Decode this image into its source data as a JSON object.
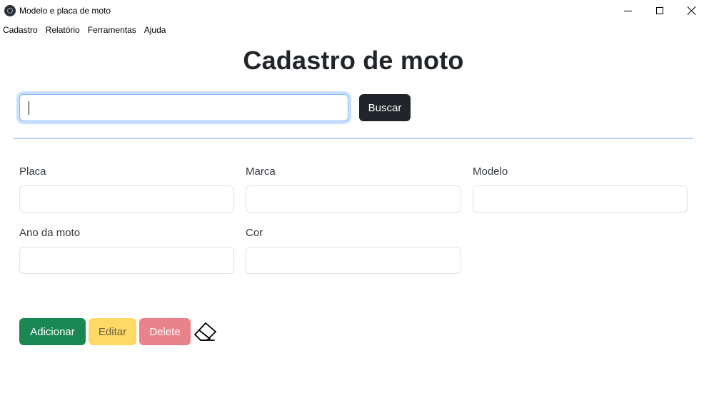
{
  "window": {
    "title": "Modelo e placa de moto",
    "controls": [
      "minimize",
      "maximize",
      "close"
    ]
  },
  "menu": {
    "items": [
      "Cadastro",
      "Relatório",
      "Ferramentas",
      "Ajuda"
    ]
  },
  "page": {
    "title": "Cadastro de moto"
  },
  "search": {
    "value": "",
    "button_label": "Buscar"
  },
  "form": {
    "placa_label": "Placa",
    "marca_label": "Marca",
    "modelo_label": "Modelo",
    "ano_label": "Ano da moto",
    "cor_label": "Cor",
    "placa_value": "",
    "marca_value": "",
    "modelo_value": "",
    "ano_value": "",
    "cor_value": ""
  },
  "actions": {
    "add_label": "Adicionar",
    "edit_label": "Editar",
    "delete_label": "Delete",
    "clear_icon": "eraser-icon"
  },
  "colors": {
    "dark": "#212529",
    "success": "#198754",
    "warning": "#ffd966",
    "danger": "#e8838b",
    "focus": "#86b7fe"
  }
}
